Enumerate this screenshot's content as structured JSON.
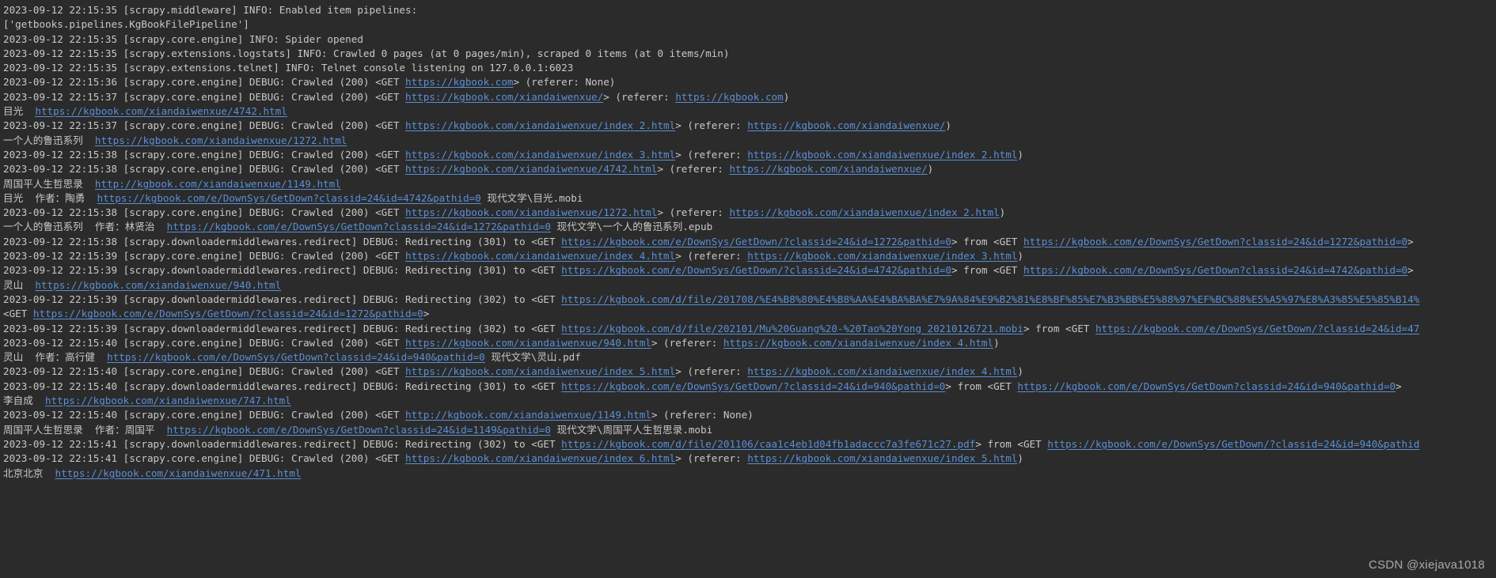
{
  "console": {
    "background_color": "#2b2b2b",
    "text_color": "#c8c8c8",
    "link_color": "#5a8fd6",
    "lines": [
      {
        "id": "line-1",
        "segments": [
          {
            "type": "text",
            "text": "2023-09-12 22:15:35 [scrapy.middleware] INFO: Enabled item pipelines:"
          }
        ]
      },
      {
        "id": "line-2",
        "segments": [
          {
            "type": "text",
            "text": "['getbooks.pipelines.KgBookFilePipeline']"
          }
        ]
      },
      {
        "id": "line-3",
        "segments": [
          {
            "type": "text",
            "text": "2023-09-12 22:15:35 [scrapy.core.engine] INFO: Spider opened"
          }
        ]
      },
      {
        "id": "line-4",
        "segments": [
          {
            "type": "text",
            "text": "2023-09-12 22:15:35 [scrapy.extensions.logstats] INFO: Crawled 0 pages (at 0 pages/min), scraped 0 items (at 0 items/min)"
          }
        ]
      },
      {
        "id": "line-5",
        "segments": [
          {
            "type": "text",
            "text": "2023-09-12 22:15:35 [scrapy.extensions.telnet] INFO: Telnet console listening on 127.0.0.1:6023"
          }
        ]
      },
      {
        "id": "line-6",
        "segments": [
          {
            "type": "text",
            "text": "2023-09-12 22:15:36 [scrapy.core.engine] DEBUG: Crawled (200) <GET "
          },
          {
            "type": "link",
            "text": "https://kgbook.com"
          },
          {
            "type": "text",
            "text": "> (referer: None)"
          }
        ]
      },
      {
        "id": "line-7",
        "segments": [
          {
            "type": "text",
            "text": "2023-09-12 22:15:37 [scrapy.core.engine] DEBUG: Crawled (200) <GET "
          },
          {
            "type": "link",
            "text": "https://kgbook.com/xiandaiwenxue/"
          },
          {
            "type": "text",
            "text": "> (referer: "
          },
          {
            "type": "link",
            "text": "https://kgbook.com"
          },
          {
            "type": "text",
            "text": ")"
          }
        ]
      },
      {
        "id": "line-8",
        "segments": [
          {
            "type": "cjk",
            "text": "目光"
          },
          {
            "type": "text",
            "text": "  "
          },
          {
            "type": "link",
            "text": "https://kgbook.com/xiandaiwenxue/4742.html"
          }
        ]
      },
      {
        "id": "line-9",
        "segments": [
          {
            "type": "text",
            "text": "2023-09-12 22:15:37 [scrapy.core.engine] DEBUG: Crawled (200) <GET "
          },
          {
            "type": "link",
            "text": "https://kgbook.com/xiandaiwenxue/index_2.html"
          },
          {
            "type": "text",
            "text": "> (referer: "
          },
          {
            "type": "link",
            "text": "https://kgbook.com/xiandaiwenxue/"
          },
          {
            "type": "text",
            "text": ")"
          }
        ]
      },
      {
        "id": "line-10",
        "segments": [
          {
            "type": "cjk",
            "text": "一个人的鲁迅系列"
          },
          {
            "type": "text",
            "text": "  "
          },
          {
            "type": "link",
            "text": "https://kgbook.com/xiandaiwenxue/1272.html"
          }
        ]
      },
      {
        "id": "line-11",
        "segments": [
          {
            "type": "text",
            "text": "2023-09-12 22:15:38 [scrapy.core.engine] DEBUG: Crawled (200) <GET "
          },
          {
            "type": "link",
            "text": "https://kgbook.com/xiandaiwenxue/index_3.html"
          },
          {
            "type": "text",
            "text": "> (referer: "
          },
          {
            "type": "link",
            "text": "https://kgbook.com/xiandaiwenxue/index_2.html"
          },
          {
            "type": "text",
            "text": ")"
          }
        ]
      },
      {
        "id": "line-12",
        "segments": [
          {
            "type": "text",
            "text": "2023-09-12 22:15:38 [scrapy.core.engine] DEBUG: Crawled (200) <GET "
          },
          {
            "type": "link",
            "text": "https://kgbook.com/xiandaiwenxue/4742.html"
          },
          {
            "type": "text",
            "text": "> (referer: "
          },
          {
            "type": "link",
            "text": "https://kgbook.com/xiandaiwenxue/"
          },
          {
            "type": "text",
            "text": ")"
          }
        ]
      },
      {
        "id": "line-13",
        "segments": [
          {
            "type": "cjk",
            "text": "周国平人生哲思录"
          },
          {
            "type": "text",
            "text": "  "
          },
          {
            "type": "link",
            "text": "http://kgbook.com/xiandaiwenxue/1149.html"
          }
        ]
      },
      {
        "id": "line-14",
        "segments": [
          {
            "type": "cjk",
            "text": "目光"
          },
          {
            "type": "text",
            "text": "  "
          },
          {
            "type": "cjk",
            "text": "作者：陶勇"
          },
          {
            "type": "text",
            "text": "  "
          },
          {
            "type": "link",
            "text": "https://kgbook.com/e/DownSys/GetDown?classid=24&id=4742&pathid=0"
          },
          {
            "type": "text",
            "text": " "
          },
          {
            "type": "cjk",
            "text": "现代文学"
          },
          {
            "type": "text",
            "text": "\\"
          },
          {
            "type": "cjk",
            "text": "目光"
          },
          {
            "type": "text",
            "text": ".mobi"
          }
        ]
      },
      {
        "id": "line-15",
        "segments": [
          {
            "type": "text",
            "text": "2023-09-12 22:15:38 [scrapy.core.engine] DEBUG: Crawled (200) <GET "
          },
          {
            "type": "link",
            "text": "https://kgbook.com/xiandaiwenxue/1272.html"
          },
          {
            "type": "text",
            "text": "> (referer: "
          },
          {
            "type": "link",
            "text": "https://kgbook.com/xiandaiwenxue/index_2.html"
          },
          {
            "type": "text",
            "text": ")"
          }
        ]
      },
      {
        "id": "line-16",
        "segments": [
          {
            "type": "cjk",
            "text": "一个人的鲁迅系列"
          },
          {
            "type": "text",
            "text": "  "
          },
          {
            "type": "cjk",
            "text": "作者：林贤治"
          },
          {
            "type": "text",
            "text": "  "
          },
          {
            "type": "link",
            "text": "https://kgbook.com/e/DownSys/GetDown?classid=24&id=1272&pathid=0"
          },
          {
            "type": "text",
            "text": " "
          },
          {
            "type": "cjk",
            "text": "现代文学"
          },
          {
            "type": "text",
            "text": "\\"
          },
          {
            "type": "cjk",
            "text": "一个人的鲁迅系列"
          },
          {
            "type": "text",
            "text": ".epub"
          }
        ]
      },
      {
        "id": "line-17",
        "segments": [
          {
            "type": "text",
            "text": "2023-09-12 22:15:38 [scrapy.downloadermiddlewares.redirect] DEBUG: Redirecting (301) to <GET "
          },
          {
            "type": "link",
            "text": "https://kgbook.com/e/DownSys/GetDown/?classid=24&id=1272&pathid=0"
          },
          {
            "type": "text",
            "text": "> from <GET "
          },
          {
            "type": "link",
            "text": "https://kgbook.com/e/DownSys/GetDown?classid=24&id=1272&pathid=0"
          },
          {
            "type": "text",
            "text": ">"
          }
        ]
      },
      {
        "id": "line-18",
        "segments": [
          {
            "type": "text",
            "text": "2023-09-12 22:15:39 [scrapy.core.engine] DEBUG: Crawled (200) <GET "
          },
          {
            "type": "link",
            "text": "https://kgbook.com/xiandaiwenxue/index_4.html"
          },
          {
            "type": "text",
            "text": "> (referer: "
          },
          {
            "type": "link",
            "text": "https://kgbook.com/xiandaiwenxue/index_3.html"
          },
          {
            "type": "text",
            "text": ")"
          }
        ]
      },
      {
        "id": "line-19",
        "segments": [
          {
            "type": "text",
            "text": "2023-09-12 22:15:39 [scrapy.downloadermiddlewares.redirect] DEBUG: Redirecting (301) to <GET "
          },
          {
            "type": "link",
            "text": "https://kgbook.com/e/DownSys/GetDown/?classid=24&id=4742&pathid=0"
          },
          {
            "type": "text",
            "text": "> from <GET "
          },
          {
            "type": "link",
            "text": "https://kgbook.com/e/DownSys/GetDown?classid=24&id=4742&pathid=0"
          },
          {
            "type": "text",
            "text": ">"
          }
        ]
      },
      {
        "id": "line-20",
        "segments": [
          {
            "type": "cjk",
            "text": "灵山"
          },
          {
            "type": "text",
            "text": "  "
          },
          {
            "type": "link",
            "text": "https://kgbook.com/xiandaiwenxue/940.html"
          }
        ]
      },
      {
        "id": "line-21",
        "segments": [
          {
            "type": "text",
            "text": "2023-09-12 22:15:39 [scrapy.downloadermiddlewares.redirect] DEBUG: Redirecting (302) to <GET "
          },
          {
            "type": "link",
            "text": "https://kgbook.com/d/file/201708/%E4%B8%80%E4%B8%AA%E4%BA%BA%E7%9A%84%E9%B2%81%E8%BF%85%E7%B3%BB%E5%88%97%EF%BC%88%E5%A5%97%E8%A3%85%E5%85%B14%"
          }
        ]
      },
      {
        "id": "line-22",
        "segments": [
          {
            "type": "text",
            "text": "<GET "
          },
          {
            "type": "link",
            "text": "https://kgbook.com/e/DownSys/GetDown/?classid=24&id=1272&pathid=0"
          },
          {
            "type": "text",
            "text": ">"
          }
        ]
      },
      {
        "id": "line-23",
        "segments": [
          {
            "type": "text",
            "text": "2023-09-12 22:15:39 [scrapy.downloadermiddlewares.redirect] DEBUG: Redirecting (302) to <GET "
          },
          {
            "type": "link",
            "text": "https://kgbook.com/d/file/202101/Mu%20Guang%20-%20Tao%20Yong_20210126721.mobi"
          },
          {
            "type": "text",
            "text": "> from <GET "
          },
          {
            "type": "link",
            "text": "https://kgbook.com/e/DownSys/GetDown/?classid=24&id=47"
          }
        ]
      },
      {
        "id": "line-24",
        "segments": [
          {
            "type": "text",
            "text": "2023-09-12 22:15:40 [scrapy.core.engine] DEBUG: Crawled (200) <GET "
          },
          {
            "type": "link",
            "text": "https://kgbook.com/xiandaiwenxue/940.html"
          },
          {
            "type": "text",
            "text": "> (referer: "
          },
          {
            "type": "link",
            "text": "https://kgbook.com/xiandaiwenxue/index_4.html"
          },
          {
            "type": "text",
            "text": ")"
          }
        ]
      },
      {
        "id": "line-25",
        "segments": [
          {
            "type": "cjk",
            "text": "灵山"
          },
          {
            "type": "text",
            "text": "  "
          },
          {
            "type": "cjk",
            "text": "作者：高行健"
          },
          {
            "type": "text",
            "text": "  "
          },
          {
            "type": "link",
            "text": "https://kgbook.com/e/DownSys/GetDown?classid=24&id=940&pathid=0"
          },
          {
            "type": "text",
            "text": " "
          },
          {
            "type": "cjk",
            "text": "现代文学"
          },
          {
            "type": "text",
            "text": "\\"
          },
          {
            "type": "cjk",
            "text": "灵山"
          },
          {
            "type": "text",
            "text": ".pdf"
          }
        ]
      },
      {
        "id": "line-26",
        "segments": [
          {
            "type": "text",
            "text": "2023-09-12 22:15:40 [scrapy.core.engine] DEBUG: Crawled (200) <GET "
          },
          {
            "type": "link",
            "text": "https://kgbook.com/xiandaiwenxue/index_5.html"
          },
          {
            "type": "text",
            "text": "> (referer: "
          },
          {
            "type": "link",
            "text": "https://kgbook.com/xiandaiwenxue/index_4.html"
          },
          {
            "type": "text",
            "text": ")"
          }
        ]
      },
      {
        "id": "line-27",
        "segments": [
          {
            "type": "text",
            "text": "2023-09-12 22:15:40 [scrapy.downloadermiddlewares.redirect] DEBUG: Redirecting (301) to <GET "
          },
          {
            "type": "link",
            "text": "https://kgbook.com/e/DownSys/GetDown/?classid=24&id=940&pathid=0"
          },
          {
            "type": "text",
            "text": "> from <GET "
          },
          {
            "type": "link",
            "text": "https://kgbook.com/e/DownSys/GetDown?classid=24&id=940&pathid=0"
          },
          {
            "type": "text",
            "text": ">"
          }
        ]
      },
      {
        "id": "line-28",
        "segments": [
          {
            "type": "cjk",
            "text": "李自成"
          },
          {
            "type": "text",
            "text": "  "
          },
          {
            "type": "link",
            "text": "https://kgbook.com/xiandaiwenxue/747.html"
          }
        ]
      },
      {
        "id": "line-29",
        "segments": [
          {
            "type": "text",
            "text": "2023-09-12 22:15:40 [scrapy.core.engine] DEBUG: Crawled (200) <GET "
          },
          {
            "type": "link",
            "text": "http://kgbook.com/xiandaiwenxue/1149.html"
          },
          {
            "type": "text",
            "text": "> (referer: None)"
          }
        ]
      },
      {
        "id": "line-30",
        "segments": [
          {
            "type": "cjk",
            "text": "周国平人生哲思录"
          },
          {
            "type": "text",
            "text": "  "
          },
          {
            "type": "cjk",
            "text": "作者：周国平"
          },
          {
            "type": "text",
            "text": "  "
          },
          {
            "type": "link",
            "text": "https://kgbook.com/e/DownSys/GetDown?classid=24&id=1149&pathid=0"
          },
          {
            "type": "text",
            "text": " "
          },
          {
            "type": "cjk",
            "text": "现代文学"
          },
          {
            "type": "text",
            "text": "\\"
          },
          {
            "type": "cjk",
            "text": "周国平人生哲思录"
          },
          {
            "type": "text",
            "text": ".mobi"
          }
        ]
      },
      {
        "id": "line-31",
        "segments": [
          {
            "type": "text",
            "text": "2023-09-12 22:15:41 [scrapy.downloadermiddlewares.redirect] DEBUG: Redirecting (302) to <GET "
          },
          {
            "type": "link",
            "text": "https://kgbook.com/d/file/201106/caa1c4eb1d04fb1adaccc7a3fe671c27.pdf"
          },
          {
            "type": "text",
            "text": "> from <GET "
          },
          {
            "type": "link",
            "text": "https://kgbook.com/e/DownSys/GetDown/?classid=24&id=940&pathid"
          }
        ]
      },
      {
        "id": "line-32",
        "segments": [
          {
            "type": "text",
            "text": "2023-09-12 22:15:41 [scrapy.core.engine] DEBUG: Crawled (200) <GET "
          },
          {
            "type": "link",
            "text": "https://kgbook.com/xiandaiwenxue/index_6.html"
          },
          {
            "type": "text",
            "text": "> (referer: "
          },
          {
            "type": "link",
            "text": "https://kgbook.com/xiandaiwenxue/index_5.html"
          },
          {
            "type": "text",
            "text": ")"
          }
        ]
      },
      {
        "id": "line-33",
        "segments": [
          {
            "type": "cjk",
            "text": "北京北京"
          },
          {
            "type": "text",
            "text": "  "
          },
          {
            "type": "link",
            "text": "https://kgbook.com/xiandaiwenxue/471.html"
          }
        ]
      }
    ]
  },
  "watermark": {
    "text": "CSDN @xiejava1018"
  }
}
